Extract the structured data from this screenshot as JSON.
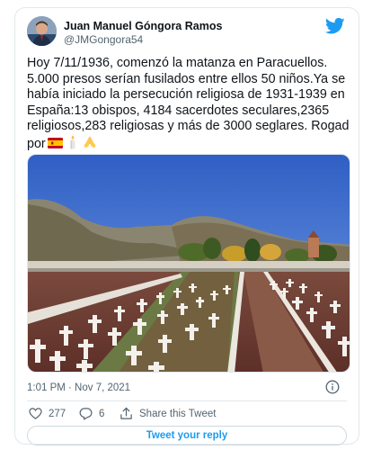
{
  "tweet": {
    "author_name": "Juan Manuel Góngora Ramos",
    "author_handle": "@JMGongora54",
    "text": "Hoy 7/11/1936, comenzó la matanza en Paracuellos. 5.000 presos serían fusilados entre ellos 50 niños.Ya se había iniciado la persecución religiosa de 1931-1939 en España:13 obispos, 4184 sacerdotes seculares,2365 religiosos,283 religiosas y más de 3000 seglares. Rogad por",
    "emojis": [
      "spain-flag",
      "candle",
      "praying-hands"
    ],
    "timestamp": "1:01 PM · Nov 7, 2021",
    "likes": "277",
    "replies": "6",
    "share_label": "Share this Tweet",
    "reply_button_label": "Tweet your reply"
  },
  "colors": {
    "brand": "#1d9bf0",
    "text": "#0f1419",
    "secondary": "#536471"
  }
}
